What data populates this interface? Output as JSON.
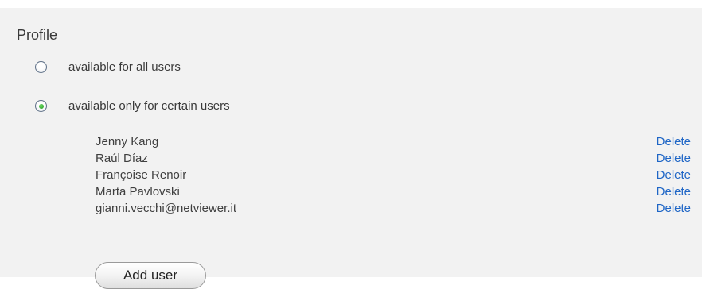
{
  "profile": {
    "title": "Profile",
    "options": [
      {
        "label": "available for all users",
        "selected": false
      },
      {
        "label": "available only for certain users",
        "selected": true
      }
    ],
    "users": [
      {
        "name": "Jenny Kang",
        "action": "Delete"
      },
      {
        "name": "Raúl Díaz",
        "action": "Delete"
      },
      {
        "name": "Françoise Renoir",
        "action": "Delete"
      },
      {
        "name": "Marta Pavlovski",
        "action": "Delete"
      },
      {
        "name": "gianni.vecchi@netviewer.it",
        "action": "Delete"
      }
    ],
    "add_button_label": "Add user"
  },
  "colors": {
    "panel_background": "#f2f2f2",
    "link": "#1f66c6",
    "radio_selected": "#2ba52b"
  }
}
